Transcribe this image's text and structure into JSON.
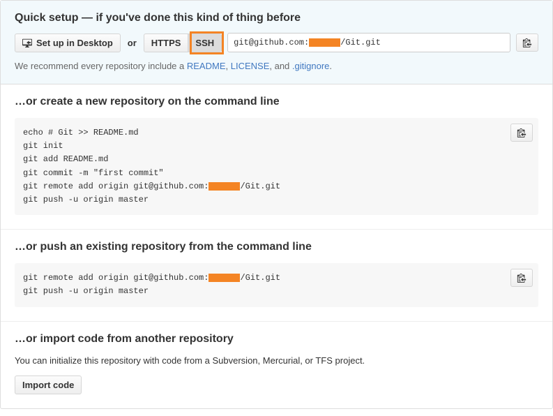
{
  "quickSetup": {
    "heading": "Quick setup — if you've done this kind of thing before",
    "desktopButton": "Set up in Desktop",
    "orText": "or",
    "httpsLabel": "HTTPS",
    "sshLabel": "SSH",
    "urlPrefix": "git@github.com:",
    "urlSuffix": "/Git.git",
    "recommendPrefix": "We recommend every repository include a ",
    "readmeLink": "README",
    "licenseLink": "LICENSE",
    "gitignoreLink": ".gitignore",
    "recommendAnd": ", and ",
    "recommendComma": ", ",
    "recommendEnd": "."
  },
  "createRepo": {
    "heading": "…or create a new repository on the command line",
    "lines": [
      "echo # Git >> README.md",
      "git init",
      "git add README.md",
      "git commit -m \"first commit\""
    ],
    "remotePrefix": "git remote add origin git@github.com:",
    "remoteSuffix": "/Git.git",
    "pushLine": "git push -u origin master"
  },
  "pushRepo": {
    "heading": "…or push an existing repository from the command line",
    "remotePrefix": "git remote add origin git@github.com:",
    "remoteSuffix": "/Git.git",
    "pushLine": "git push -u origin master"
  },
  "importRepo": {
    "heading": "…or import code from another repository",
    "text": "You can initialize this repository with code from a Subversion, Mercurial, or TFS project.",
    "buttonLabel": "Import code"
  }
}
